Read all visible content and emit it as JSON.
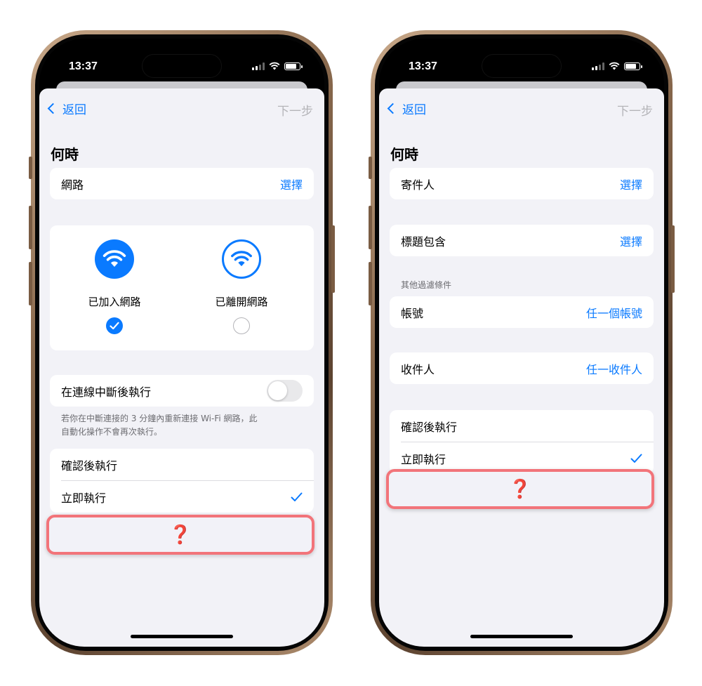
{
  "status_bar": {
    "time": "13:37"
  },
  "colors": {
    "accent": "#0a7aff",
    "highlight_border": "#f2747a",
    "question_mark": "#e01d2b",
    "background": "#f2f2f7"
  },
  "left_screen": {
    "nav": {
      "back_label": "返回",
      "next_label": "下一步"
    },
    "heading": "何時",
    "network_row": {
      "label": "網路",
      "value": "選擇"
    },
    "wifi_options": [
      {
        "label": "已加入網路",
        "icon": "wifi-filled-icon",
        "selected": true
      },
      {
        "label": "已離開網路",
        "icon": "wifi-outline-icon",
        "selected": false
      }
    ],
    "disconnect_row": {
      "label": "在連線中斷後執行",
      "toggle_on": false
    },
    "disconnect_caption_1": "若你在中斷連接的 3 分鐘內重新連接 Wi-Fi 網路，此",
    "disconnect_caption_2": "自動化操作不會再次執行。",
    "run_options": [
      {
        "label": "確認後執行",
        "checked": false
      },
      {
        "label": "立即執行",
        "checked": true
      }
    ],
    "question_mark": "❓"
  },
  "right_screen": {
    "nav": {
      "back_label": "返回",
      "next_label": "下一步"
    },
    "heading": "何時",
    "sender_row": {
      "label": "寄件人",
      "value": "選擇"
    },
    "subject_row": {
      "label": "標題包含",
      "value": "選擇"
    },
    "filter_section_title": "其他過濾條件",
    "account_row": {
      "label": "帳號",
      "value": "任一個帳號"
    },
    "recipient_row": {
      "label": "收件人",
      "value": "任一收件人"
    },
    "run_options": [
      {
        "label": "確認後執行",
        "checked": false
      },
      {
        "label": "立即執行",
        "checked": true
      }
    ],
    "question_mark": "❓"
  }
}
